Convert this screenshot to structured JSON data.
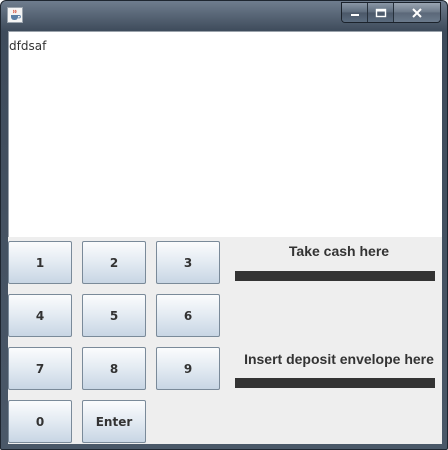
{
  "window": {
    "icon": "java-cup-icon",
    "controls": [
      "minimize-icon",
      "maximize-icon",
      "close-icon"
    ]
  },
  "display": {
    "text": "dfdsaf"
  },
  "keypad": {
    "keys": [
      "1",
      "2",
      "3",
      "4",
      "5",
      "6",
      "7",
      "8",
      "9",
      "0",
      "Enter"
    ]
  },
  "cash_dispenser": {
    "label": "Take cash here"
  },
  "deposit_slot": {
    "label": "Insert deposit envelope here"
  },
  "colors": {
    "slot_bar": "#333333",
    "button_gradient_top": "#fbfcfd",
    "button_gradient_bottom": "#c8d6e4",
    "panel_background": "#eeeeee"
  }
}
